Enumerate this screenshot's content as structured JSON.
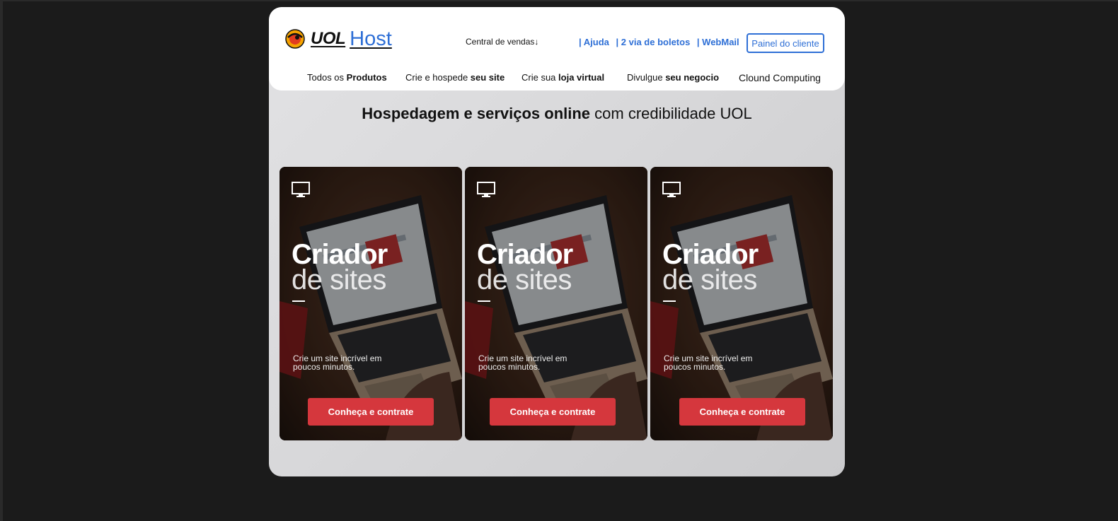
{
  "header": {
    "logo": {
      "brand": "UOL",
      "product": "Host"
    },
    "central_vendas": "Central de vendas↓",
    "top_links": [
      "| Ajuda",
      "| 2 via de boletos",
      "| WebMail"
    ],
    "painel_button": "Painel do cliente",
    "nav": [
      {
        "plain": "Todos os ",
        "bold": "Produtos"
      },
      {
        "plain": "Crie e hospede ",
        "bold": "seu site"
      },
      {
        "plain": "Crie sua ",
        "bold": "loja virtual"
      },
      {
        "plain": "Divulgue ",
        "bold": "seu negocio"
      },
      {
        "plain": "Clound Computing",
        "bold": ""
      }
    ]
  },
  "headline": {
    "bold": "Hospedagem e serviços online",
    "plain": " com credibilidade UOL"
  },
  "cards": [
    {
      "title": "Criador",
      "subtitle": "de sites",
      "description": "Crie um site incrível em poucos minutos.",
      "button": "Conheça e contrate",
      "icon": "monitor-icon"
    },
    {
      "title": "Criador",
      "subtitle": "de sites",
      "description": "Crie um site incrível em poucos minutos.",
      "button": "Conheça e contrate",
      "icon": "monitor-icon"
    },
    {
      "title": "Criador",
      "subtitle": "de sites",
      "description": "Crie um site incrível em poucos minutos.",
      "button": "Conheça e contrate",
      "icon": "monitor-icon"
    }
  ],
  "colors": {
    "accent_blue": "#2e6fd6",
    "button_red": "#d5373d",
    "page_bg": "#1b1b1b"
  }
}
